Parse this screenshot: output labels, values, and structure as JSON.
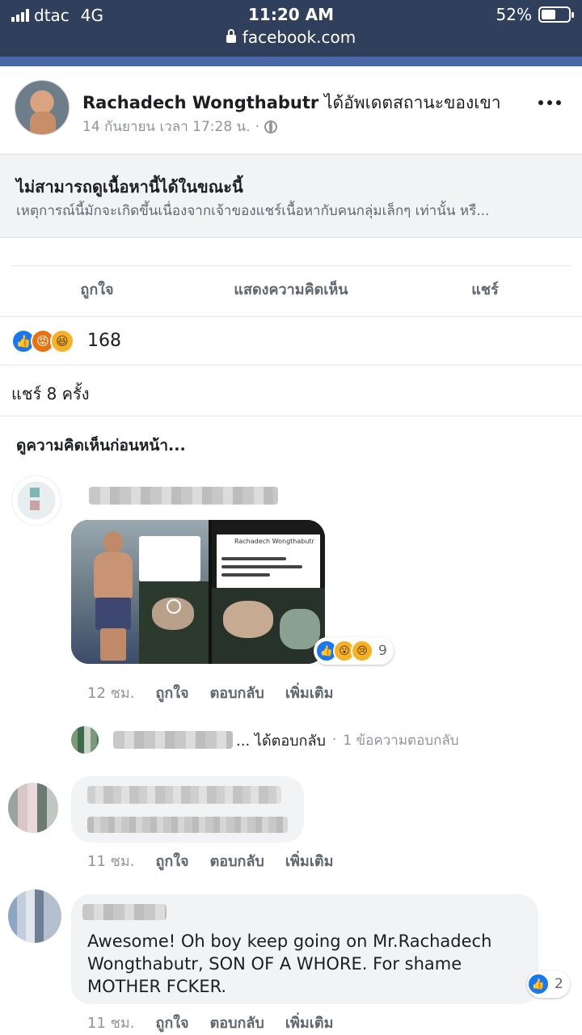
{
  "status_bar": {
    "carrier": "dtac",
    "network": "4G",
    "time": "11:20 AM",
    "battery": "52%",
    "battery_level": 0.52
  },
  "browser": {
    "url": "facebook.com"
  },
  "post": {
    "author": "Rachadech Wongthabutr",
    "action": "ได้อัพเดตสถานะของเขา",
    "date": "14 กันยายน เวลา 17:28 น.",
    "separator": "·",
    "privacy_icon": "globe-icon",
    "more_icon": "more-dots-icon"
  },
  "unavailable": {
    "title": "ไม่สามารถดูเนื้อหานี้ได้ในขณะนี้",
    "description": "เหตุการณ์นี้มักจะเกิดขึ้นเนื่องจากเจ้าของแชร์เนื้อหากับคนกลุ่มเล็กๆ เท่านั้น หรื..."
  },
  "actions": {
    "like": "ถูกใจ",
    "comment": "แสดงความคิดเห็น",
    "share": "แชร์"
  },
  "reactions": {
    "types": [
      "like",
      "angry",
      "haha"
    ],
    "count": "168"
  },
  "shares": "แชร์ 8 ครั้ง",
  "prev_comments": "ดูความคิดเห็นก่อนหน้า...",
  "comments": [
    {
      "has_image": true,
      "image_text": {
        "profile_name": "Rachadech Wongthabutr"
      },
      "image_reactions": {
        "types": [
          "like",
          "wow",
          "sad"
        ],
        "count": "9"
      },
      "time": "12 ชม.",
      "like": "ถูกใจ",
      "reply": "ตอบกลับ",
      "more": "เพิ่มเติม",
      "reply_summary": {
        "ellipsis": "... ได้ตอบกลับ",
        "separator": "·",
        "count_text": "1 ข้อความตอบกลับ"
      }
    },
    {
      "time": "11 ชม.",
      "like": "ถูกใจ",
      "reply": "ตอบกลับ",
      "more": "เพิ่มเติม"
    },
    {
      "text": "Awesome! Oh boy keep going on Mr.Rachadech Wongthabutr, SON OF A WHORE. For shame MOTHER FCKER.",
      "reactions": {
        "types": [
          "like"
        ],
        "count": "2"
      },
      "time": "11 ชม.",
      "like": "ถูกใจ",
      "reply": "ตอบกลับ",
      "more": "เพิ่มเติม"
    }
  ]
}
